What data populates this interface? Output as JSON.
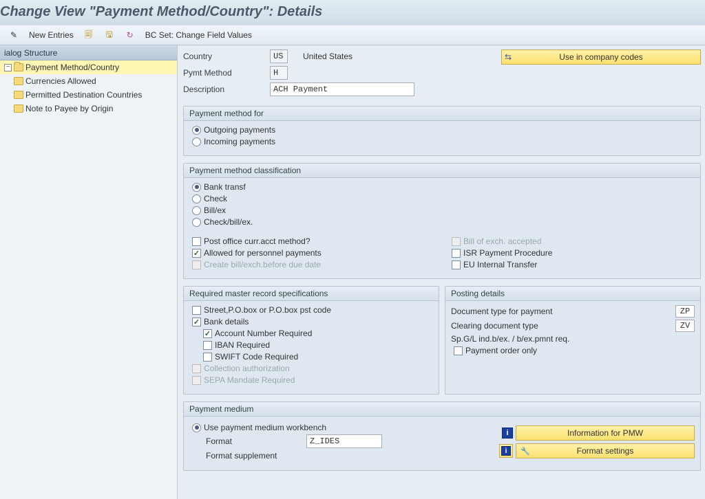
{
  "title": "Change View \"Payment Method/Country\": Details",
  "toolbar": {
    "new_entries": "New Entries",
    "bcset": "BC Set: Change Field Values"
  },
  "tree": {
    "header": "ialog Structure",
    "root": "Payment Method/Country",
    "children": [
      "Currencies Allowed",
      "Permitted Destination Countries",
      "Note to Payee by Origin"
    ]
  },
  "header": {
    "country_label": "Country",
    "country_code": "US",
    "country_name": "United States",
    "pymt_label": "Pymt Method",
    "pymt_code": "H",
    "desc_label": "Description",
    "desc_value": "ACH Payment",
    "use_company": "Use in company codes"
  },
  "pm_for": {
    "title": "Payment method for",
    "outgoing": "Outgoing payments",
    "incoming": "Incoming payments"
  },
  "pm_class": {
    "title": "Payment method classification",
    "bank": "Bank transf",
    "check": "Check",
    "bill": "Bill/ex",
    "checkbill": "Check/bill/ex.",
    "postoffice": "Post office curr.acct method?",
    "personnel": "Allowed for personnel payments",
    "createbill": "Create bill/exch.before due date",
    "billacc": "Bill of exch. accepted",
    "isr": "ISR Payment Procedure",
    "eu": "EU Internal Transfer"
  },
  "req": {
    "title": "Required master record specifications",
    "street": "Street,P.O.box or P.O.box pst code",
    "bank": "Bank details",
    "acct": "Account Number Required",
    "iban": "IBAN Required",
    "swift": "SWIFT Code Required",
    "coll": "Collection authorization",
    "sepa": "SEPA Mandate Required"
  },
  "posting": {
    "title": "Posting details",
    "doctype_label": "Document type for payment",
    "doctype_val": "ZP",
    "clear_label": "Clearing document type",
    "clear_val": "ZV",
    "spgl": "Sp.G/L ind.b/ex. / b/ex.pmnt req.",
    "order_only": "Payment order only"
  },
  "medium": {
    "title": "Payment medium",
    "workbench": "Use payment medium workbench",
    "format_label": "Format",
    "format_val": "Z_IDES",
    "suppl_label": "Format supplement",
    "info_pmw": "Information for PMW",
    "fmt_settings": "Format settings"
  }
}
